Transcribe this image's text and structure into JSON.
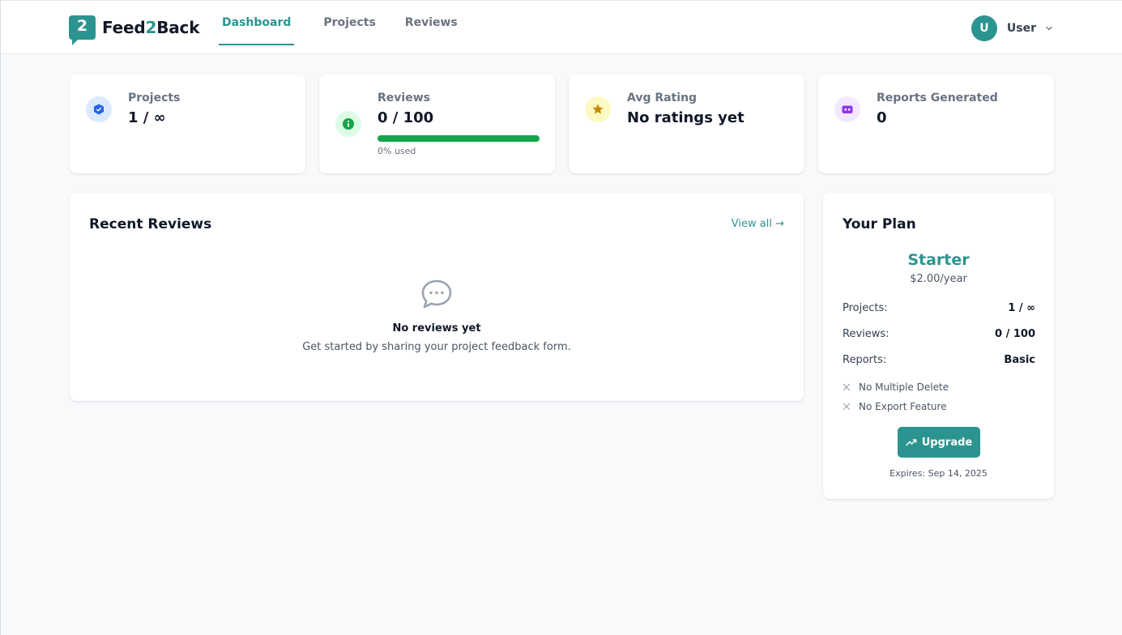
{
  "brand": {
    "mark": "2",
    "name_prefix": "Feed",
    "name_accent": "2",
    "name_suffix": "Back"
  },
  "nav": {
    "items": [
      {
        "label": "Dashboard",
        "active": true
      },
      {
        "label": "Projects",
        "active": false
      },
      {
        "label": "Reviews",
        "active": false
      }
    ]
  },
  "user": {
    "initial": "U",
    "name": "User"
  },
  "stats": [
    {
      "label": "Projects",
      "value": "1 / ∞",
      "icon": "shield-check-icon",
      "icon_color": "#2563eb",
      "icon_bg": "#dbeafe"
    },
    {
      "label": "Reviews",
      "value": "0 / 100",
      "icon": "info-circle-icon",
      "icon_color": "#16a34a",
      "icon_bg": "#dcfce7",
      "progress_percent": 0,
      "progress_caption": "0% used"
    },
    {
      "label": "Avg Rating",
      "value": "No ratings yet",
      "icon": "star-icon",
      "icon_color": "#ca8a04",
      "icon_bg": "#fef9c3"
    },
    {
      "label": "Reports Generated",
      "value": "0",
      "icon": "robot-icon",
      "icon_color": "#9333ea",
      "icon_bg": "#f3e8ff"
    }
  ],
  "recent_reviews": {
    "title": "Recent Reviews",
    "view_all": "View all →",
    "empty_icon": "chat-bubble-icon",
    "empty_title": "No reviews yet",
    "empty_subtitle": "Get started by sharing your project feedback form."
  },
  "plan": {
    "title": "Your Plan",
    "name": "Starter",
    "price": "$2.00/year",
    "rows": [
      {
        "key": "Projects:",
        "value": "1 / ∞"
      },
      {
        "key": "Reviews:",
        "value": "0 / 100"
      },
      {
        "key": "Reports:",
        "value": "Basic"
      }
    ],
    "features": [
      {
        "label": "No Multiple Delete",
        "icon": "x-icon"
      },
      {
        "label": "No Export Feature",
        "icon": "x-icon"
      }
    ],
    "upgrade_label": "Upgrade",
    "expires": "Expires: Sep 14, 2025"
  },
  "colors": {
    "accent": "#2b9490",
    "page_bg": "#f7f9fb",
    "card_bg": "#ffffff"
  }
}
